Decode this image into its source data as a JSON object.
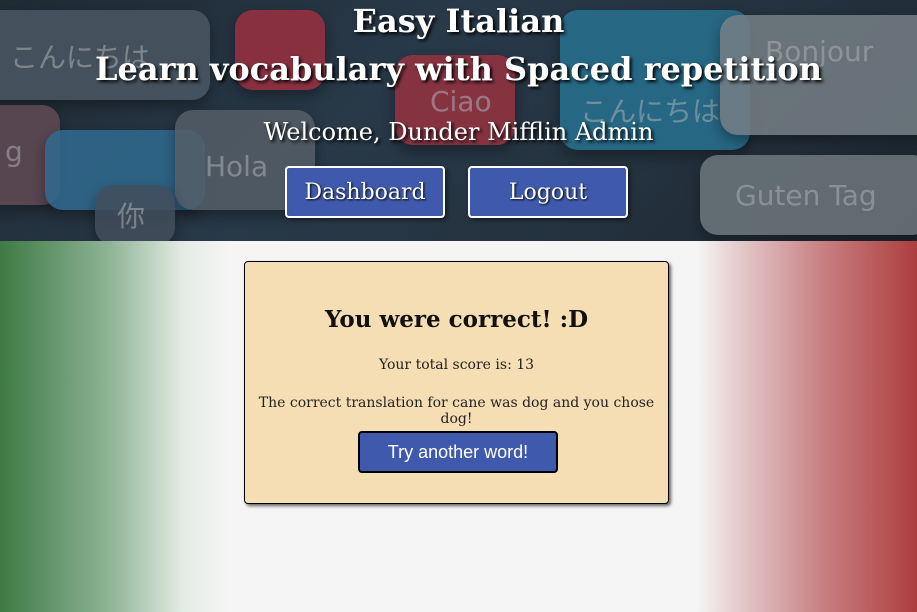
{
  "header": {
    "app_name": "Easy Italian",
    "tagline": "Learn vocabulary with Spaced repetition",
    "welcome": "Welcome, Dunder Mifflin Admin",
    "dashboard_label": "Dashboard",
    "logout_label": "Logout",
    "background_words": [
      "こんにちは",
      "Hola",
      "你",
      "Bonjour",
      "Ciao",
      "こんにちは",
      "Guten Tag",
      "g"
    ]
  },
  "feedback": {
    "heading": "You were correct! :D",
    "score_text": "Your total score is: 13",
    "translation_text": "The correct translation for cane was dog and you chose dog!",
    "next_button_label": "Try another word!"
  },
  "colors": {
    "button_blue": "#3f5aac",
    "card_background": "#f5deb3",
    "flag_green": "#3e7a44",
    "flag_red": "#ac3e3e"
  }
}
